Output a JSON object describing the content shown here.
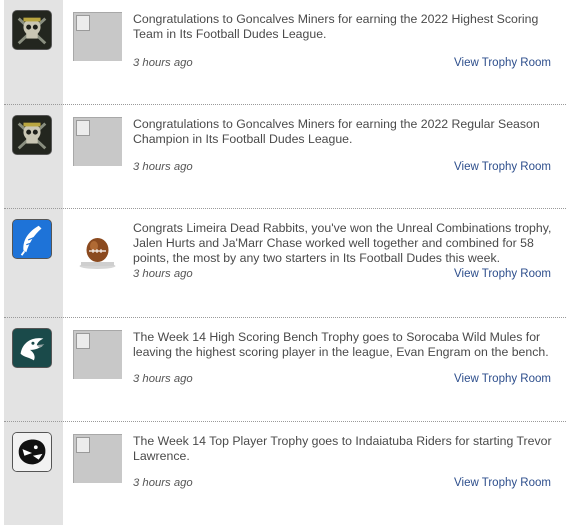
{
  "feed": {
    "items": [
      {
        "avatar_icon": "skull-miner-logo-icon",
        "thumb_icon": "broken-image-icon",
        "message": "Congratulations to Goncalves Miners for earning the 2022 Highest Scoring Team in Its Football Dudes League.",
        "time": "3 hours ago",
        "link": "View Trophy Room"
      },
      {
        "avatar_icon": "skull-miner-logo-icon",
        "thumb_icon": "broken-image-icon",
        "message": "Congratulations to Goncalves Miners for earning the 2022 Regular Season Champion in Its Football Dudes League.",
        "time": "3 hours ago",
        "link": "View Trophy Room"
      },
      {
        "avatar_icon": "blue-feather-logo-icon",
        "thumb_icon": "football-trophy-icon",
        "message": "Congrats Limeira Dead Rabbits, you've won the Unreal Combinations trophy, Jalen Hurts and Ja'Marr Chase worked well together and combined for 58 points, the most by any two starters in Its Football Dudes this week.",
        "time": "3 hours ago",
        "link": "View Trophy Room"
      },
      {
        "avatar_icon": "eagle-head-logo-icon",
        "thumb_icon": "broken-image-icon",
        "message": "The Week 14 High Scoring Bench Trophy goes to Sorocaba Wild Mules for leaving the highest scoring player in the league, Evan Engram on the bench.",
        "time": "3 hours ago",
        "link": "View Trophy Room"
      },
      {
        "avatar_icon": "panther-head-logo-icon",
        "thumb_icon": "broken-image-icon",
        "message": "The Week 14 Top Player Trophy goes to Indaiatuba Riders for starting Trevor Lawrence.",
        "time": "3 hours ago",
        "link": "View Trophy Room"
      }
    ]
  },
  "colors": {
    "link": "#2d4e8c",
    "text": "#4a4a4a",
    "rail": "#e3e3e3",
    "eagle_bg": "#1a4a4a",
    "feather_bg": "#1e73d8"
  }
}
